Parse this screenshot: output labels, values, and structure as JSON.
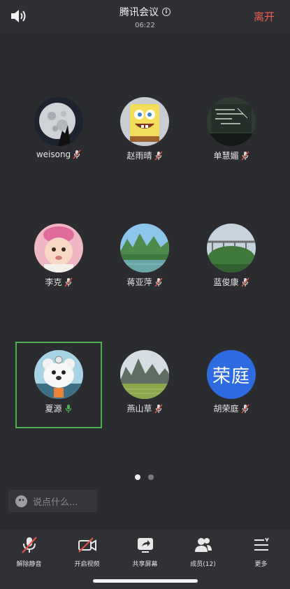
{
  "header": {
    "title": "腾讯会议",
    "timer": "06:22",
    "leave_label": "离开"
  },
  "participants": [
    {
      "name": "weisong",
      "avatar": "moon-photo",
      "mic": "muted"
    },
    {
      "name": "赵雨晴",
      "avatar": "spongebob-photo",
      "mic": "muted"
    },
    {
      "name": "单慧媚",
      "avatar": "chalkboard-photo",
      "mic": "muted"
    },
    {
      "name": "李克",
      "avatar": "baby-photo",
      "mic": "muted"
    },
    {
      "name": "蒋亚萍",
      "avatar": "karst-river-photo",
      "mic": "muted"
    },
    {
      "name": "蓝俊康",
      "avatar": "bridge-landscape-photo",
      "mic": "muted"
    },
    {
      "name": "夏源",
      "avatar": "polar-bear-cartoon",
      "mic": "speaking"
    },
    {
      "name": "燕山草",
      "avatar": "mountain-fields-photo",
      "mic": "muted"
    },
    {
      "name": "胡荣庭",
      "avatar_text": "荣庭",
      "mic": "muted"
    }
  ],
  "pager": {
    "current": 1,
    "total": 2
  },
  "chat": {
    "placeholder": "说点什么..."
  },
  "toolbar": {
    "unmute_label": "解除静音",
    "video_label": "开启视频",
    "share_label": "共享屏幕",
    "members_label": "成员(12)",
    "more_label": "更多"
  },
  "colors": {
    "background": "#2b2c30",
    "leave": "#f15c4e",
    "active_border": "#4fae4f",
    "muted_mic": "#e0534a",
    "speaking_mic": "#4fae4f",
    "text_avatar_bg": "#2f6be0"
  }
}
